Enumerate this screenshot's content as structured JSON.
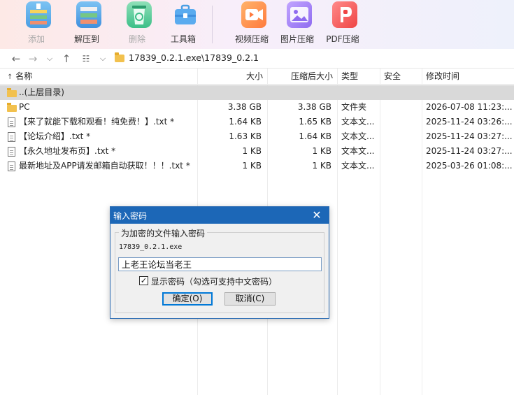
{
  "toolbar": {
    "buttons": [
      {
        "label": "添加",
        "icon": "add-archive-icon",
        "disabled": true
      },
      {
        "label": "解压到",
        "icon": "extract-icon",
        "disabled": false
      },
      {
        "label": "删除",
        "icon": "recycle-bin-icon",
        "disabled": true
      },
      {
        "label": "工具箱",
        "icon": "toolbox-icon",
        "disabled": false
      },
      {
        "label": "视频压缩",
        "icon": "video-compress-icon",
        "disabled": false
      },
      {
        "label": "图片压缩",
        "icon": "image-compress-icon",
        "disabled": false
      },
      {
        "label": "PDF压缩",
        "icon": "pdf-compress-icon",
        "disabled": false
      }
    ]
  },
  "address": {
    "path": "17839_0.2.1.exe\\17839_0.2.1"
  },
  "columns": {
    "name": "名称",
    "sort_arrow": "↑",
    "size": "大小",
    "packed": "压缩后大小",
    "type": "类型",
    "security": "安全",
    "modified": "修改时间"
  },
  "files": [
    {
      "name": "..(上层目录)",
      "size": "",
      "packed": "",
      "type": "",
      "modified": "",
      "icon": "folder"
    },
    {
      "name": "PC",
      "size": "3.38 GB",
      "packed": "3.38 GB",
      "type": "文件夹",
      "modified": "2026-07-08 11:23:...",
      "icon": "folder"
    },
    {
      "name": "【来了就能下载和观看！纯免费！】.txt *",
      "size": "1.64 KB",
      "packed": "1.65 KB",
      "type": "文本文...",
      "modified": "2025-11-24 03:26:...",
      "icon": "document"
    },
    {
      "name": "【论坛介绍】.txt *",
      "size": "1.63 KB",
      "packed": "1.64 KB",
      "type": "文本文...",
      "modified": "2025-11-24 03:27:...",
      "icon": "document"
    },
    {
      "name": "【永久地址发布页】.txt *",
      "size": "1 KB",
      "packed": "1 KB",
      "type": "文本文...",
      "modified": "2025-11-24 03:27:...",
      "icon": "document"
    },
    {
      "name": "最新地址及APP请发邮箱自动获取！！！.txt *",
      "size": "1 KB",
      "packed": "1 KB",
      "type": "文本文...",
      "modified": "2025-03-26 01:08:...",
      "icon": "document"
    }
  ],
  "dialog": {
    "title": "输入密码",
    "group_label": "为加密的文件输入密码",
    "filename": "17839_0.2.1.exe",
    "password_value": "上老王论坛当老王",
    "show_password_checked": true,
    "show_password_label": "显示密码（勾选可支持中文密码）",
    "ok_label": "确定(O)",
    "cancel_label": "取消(C)"
  },
  "colors": {
    "dialog_title_bar": "#1c67b7",
    "parent_row_bg": "#d9d9d9"
  }
}
